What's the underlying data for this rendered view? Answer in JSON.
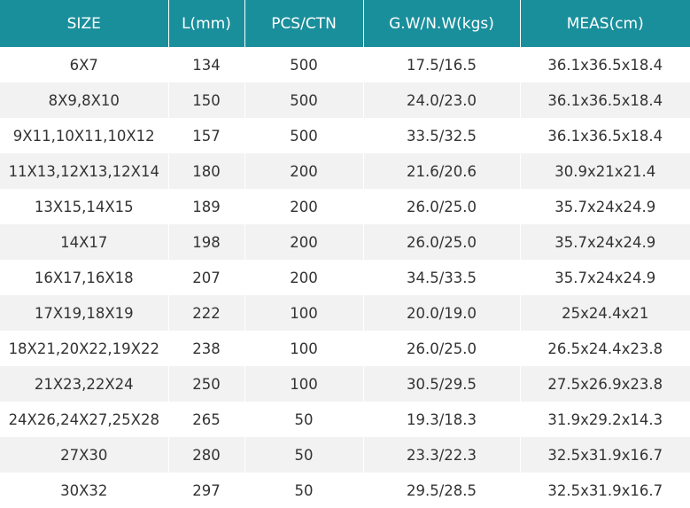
{
  "table": {
    "headers": [
      "SIZE",
      "L(mm)",
      "PCS/CTN",
      "G.W/N.W(kgs)",
      "MEAS(cm)"
    ],
    "rows": [
      [
        "6X7",
        "134",
        "500",
        "17.5/16.5",
        "36.1x36.5x18.4"
      ],
      [
        "8X9,8X10",
        "150",
        "500",
        "24.0/23.0",
        "36.1x36.5x18.4"
      ],
      [
        "9X11,10X11,10X12",
        "157",
        "500",
        "33.5/32.5",
        "36.1x36.5x18.4"
      ],
      [
        "11X13,12X13,12X14",
        "180",
        "200",
        "21.6/20.6",
        "30.9x21x21.4"
      ],
      [
        "13X15,14X15",
        "189",
        "200",
        "26.0/25.0",
        "35.7x24x24.9"
      ],
      [
        "14X17",
        "198",
        "200",
        "26.0/25.0",
        "35.7x24x24.9"
      ],
      [
        "16X17,16X18",
        "207",
        "200",
        "34.5/33.5",
        "35.7x24x24.9"
      ],
      [
        "17X19,18X19",
        "222",
        "100",
        "20.0/19.0",
        "25x24.4x21"
      ],
      [
        "18X21,20X22,19X22",
        "238",
        "100",
        "26.0/25.0",
        "26.5x24.4x23.8"
      ],
      [
        "21X23,22X24",
        "250",
        "100",
        "30.5/29.5",
        "27.5x26.9x23.8"
      ],
      [
        "24X26,24X27,25X28",
        "265",
        "50",
        "19.3/18.3",
        "31.9x29.2x14.3"
      ],
      [
        "27X30",
        "280",
        "50",
        "23.3/22.3",
        "32.5x31.9x16.7"
      ],
      [
        "30X32",
        "297",
        "50",
        "29.5/28.5",
        "32.5x31.9x16.7"
      ]
    ]
  },
  "colors": {
    "header_bg": "#1a8f9c",
    "header_text": "#ffffff",
    "row_alt_bg": "#f2f2f2",
    "cell_text": "#333333"
  }
}
